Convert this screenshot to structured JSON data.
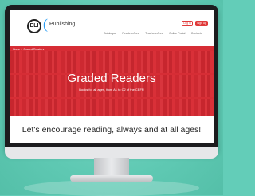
{
  "site": {
    "logo_mark": "ELI",
    "logo_name": "Publishing"
  },
  "nav": {
    "items": [
      "Catalogue",
      "Readers Area",
      "Teachers Area",
      "Online Portal",
      "Contacts"
    ],
    "login_label": "Log in",
    "signup_label": "Sign up"
  },
  "hero": {
    "breadcrumb": "Home > Graded Readers",
    "title": "Graded Readers",
    "subtitle": "Books for all ages, from A1 to C2 of the CEFR"
  },
  "tagline": "Let's encourage reading, always and at all ages!",
  "colors": {
    "background": "#63cdb8",
    "accent_red": "#d8333a",
    "logo_blue": "#2a9df4"
  }
}
